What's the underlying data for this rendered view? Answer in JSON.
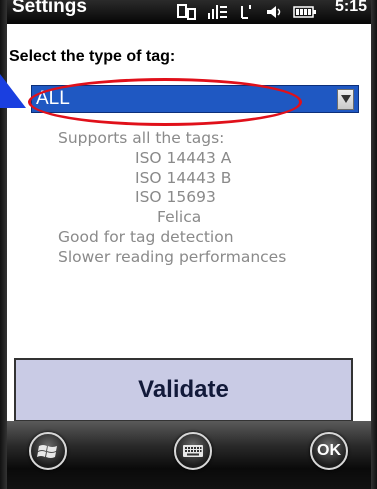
{
  "statusbar": {
    "title": "Settings",
    "time": "5:15",
    "icons": [
      "sync-icon",
      "signal-icon",
      "data-icon",
      "speaker-icon",
      "battery-icon"
    ]
  },
  "form": {
    "prompt": "Select the type of tag:",
    "selected_value": "ALL",
    "description": {
      "line1": "Supports all the tags:",
      "tags": [
        "ISO 14443 A",
        "ISO 14443 B",
        "ISO 15693",
        "Felica"
      ],
      "line_detection": "Good for tag detection",
      "line_performance": "Slower reading performances"
    },
    "validate_label": "Validate"
  },
  "taskbar": {
    "ok_label": "OK",
    "icons": [
      "windows-start-icon",
      "keyboard-icon"
    ]
  },
  "colors": {
    "select_bg": "#1f58c2",
    "validate_bg": "#c9cbe5",
    "annotation_red": "#e0101a",
    "annotation_blue": "#1a3fe0"
  }
}
